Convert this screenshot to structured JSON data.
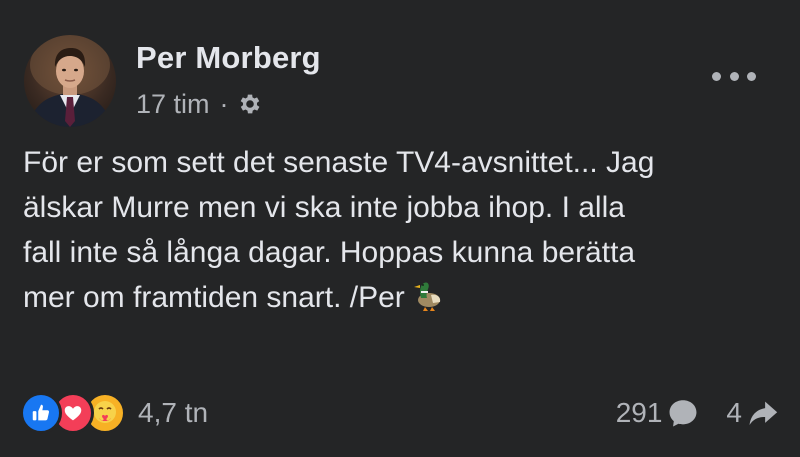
{
  "post": {
    "author": "Per Morberg",
    "time": "17 tim",
    "separator": "·",
    "privacy_icon": "gear-icon",
    "menu_icon": "more-horizontal-icon",
    "text_lines": [
      "För er som sett det senaste TV4-avsnittet... Jag",
      "älskar Murre men vi ska inte jobba ihop. I alla",
      "fall inte så långa dagar. Hoppas kunna berätta",
      "mer om framtiden snart. /Per"
    ],
    "trailing_emoji": "duck"
  },
  "footer": {
    "reactions": [
      "like",
      "love",
      "care"
    ],
    "reaction_count": "4,7 tn",
    "comment_count": "291",
    "share_count": "4",
    "comment_icon": "comment-bubble-icon",
    "share_icon": "share-arrow-icon"
  },
  "colors": {
    "background": "#242526",
    "primary_text": "#e4e6eb",
    "secondary_text": "#b0b3b8",
    "like_blue": "#1877f2",
    "love_red": "#f33e58",
    "care_yellow": "#f7b125"
  }
}
